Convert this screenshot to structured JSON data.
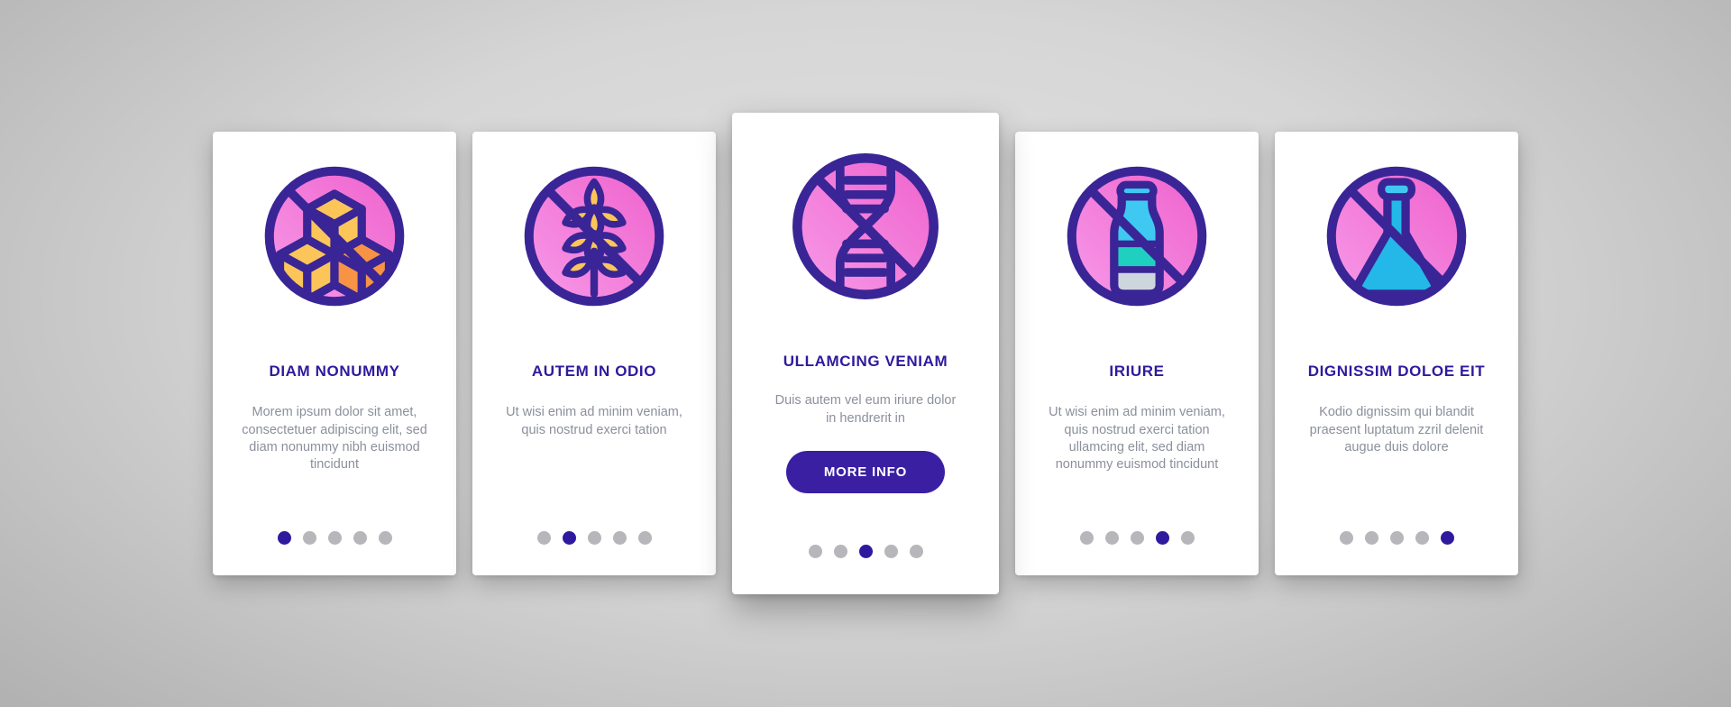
{
  "theme": {
    "accent": "#2f1a9e",
    "button_bg": "#3a1fa3",
    "icon_stroke": "#3a2596",
    "icon_circle_light": "#f79ae8",
    "icon_circle_dark": "#ef66cf",
    "body_text": "#8b909c",
    "dot_inactive": "#b6b6bb",
    "card_bg": "#ffffff",
    "page_bg": "#d6d6d6",
    "sugar_yellow": "#fbc55a",
    "sugar_orange": "#f79344",
    "milk_cyan": "#3fc9f2",
    "milk_teal": "#1fd0c0",
    "milk_grey": "#ced6dd",
    "flask_blue": "#23b8e8"
  },
  "cards": [
    {
      "icon": "no-sugar-cubes-icon",
      "title": "DIAM NONUMMY",
      "body": "Morem ipsum dolor sit amet, consectetuer adipiscing elit, sed diam nonummy nibh euismod tincidunt",
      "dots": {
        "count": 5,
        "active": 1
      },
      "featured": false,
      "button": null
    },
    {
      "icon": "no-gluten-wheat-icon",
      "title": "AUTEM IN ODIO",
      "body": "Ut wisi enim ad minim veniam, quis nostrud exerci tation",
      "dots": {
        "count": 5,
        "active": 2
      },
      "featured": false,
      "button": null
    },
    {
      "icon": "no-gmo-dna-icon",
      "title": "ULLAMCING VENIAM",
      "body": "Duis autem vel eum iriure dolor in hendrerit in",
      "dots": {
        "count": 5,
        "active": 3
      },
      "featured": true,
      "button": "MORE INFO"
    },
    {
      "icon": "no-lactose-bottle-icon",
      "title": "IRIURE",
      "body": "Ut wisi enim ad minim veniam, quis nostrud exerci tation ullamcing elit, sed diam nonummy euismod tincidunt",
      "dots": {
        "count": 5,
        "active": 4
      },
      "featured": false,
      "button": null
    },
    {
      "icon": "no-chemicals-flask-icon",
      "title": "DIGNISSIM DOLOE EIT",
      "body": "Kodio dignissim qui blandit praesent luptatum zzril delenit augue duis dolore",
      "dots": {
        "count": 5,
        "active": 5
      },
      "featured": false,
      "button": null
    }
  ]
}
